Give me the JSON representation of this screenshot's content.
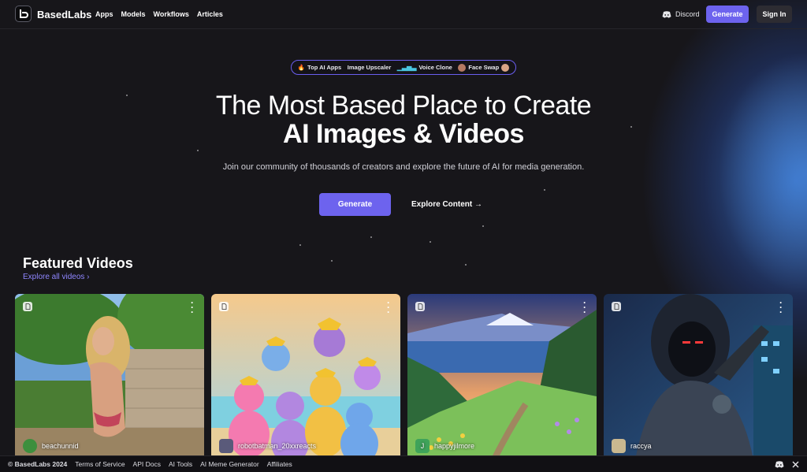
{
  "header": {
    "brand": "BasedLabs",
    "nav": [
      "Apps",
      "Models",
      "Workflows",
      "Articles"
    ],
    "discord_label": "Discord",
    "generate_label": "Generate",
    "signin_label": "Sign In"
  },
  "pill": {
    "top_apps": "Top AI Apps",
    "upscaler": "Image Upscaler",
    "voice_clone": "Voice Clone",
    "face_swap": "Face Swap"
  },
  "hero": {
    "title_line1": "The Most Based Place to Create",
    "title_line2": "AI Images & Videos",
    "subtitle": "Join our community of thousands of creators and explore the future of AI for media generation.",
    "generate_label": "Generate",
    "explore_label": "Explore Content →"
  },
  "featured": {
    "title": "Featured Videos",
    "link": "Explore all videos ›",
    "cards": [
      {
        "user": "beachunnid",
        "avatar_letter": ""
      },
      {
        "user": "robotbatman_20xxreacts",
        "avatar_letter": ""
      },
      {
        "user": "happyjilmore",
        "avatar_letter": "J"
      },
      {
        "user": "raccya",
        "avatar_letter": ""
      }
    ]
  },
  "footer": {
    "copyright": "© BasedLabs 2024",
    "links": [
      "Terms of Service",
      "API Docs",
      "AI Tools",
      "AI Meme Generator",
      "Affiliates"
    ]
  },
  "colors": {
    "accent": "#6d63ee",
    "link": "#8f86ff",
    "background": "#17161a"
  }
}
